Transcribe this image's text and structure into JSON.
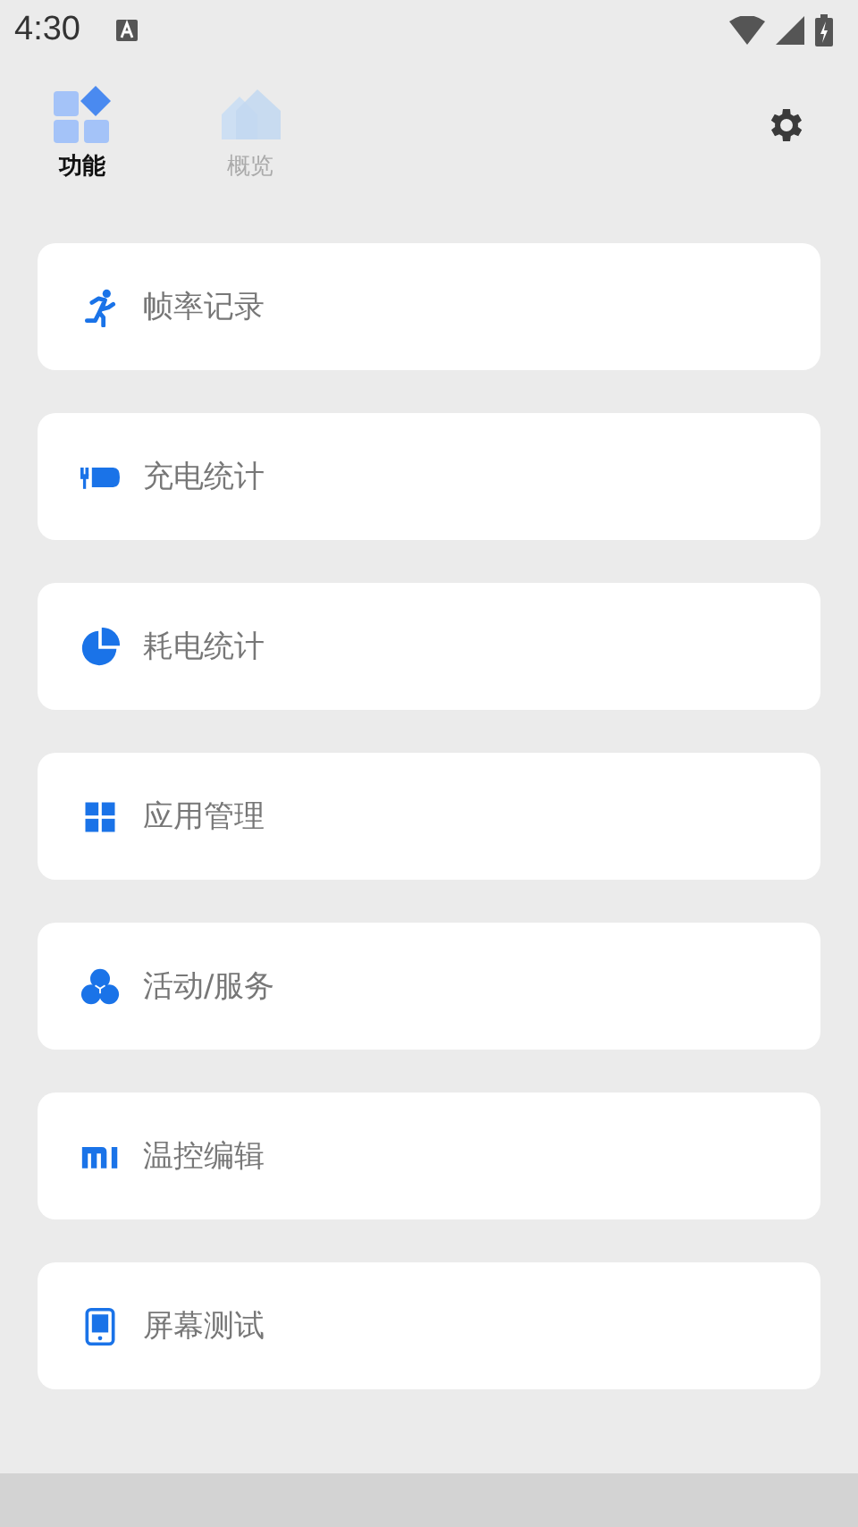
{
  "status_bar": {
    "time": "4:30"
  },
  "tabs": [
    {
      "label": "功能",
      "kind": "features",
      "selected": true
    },
    {
      "label": "概览",
      "kind": "overview",
      "selected": false
    }
  ],
  "items": [
    {
      "label": "帧率记录",
      "kind": "run"
    },
    {
      "label": "充电统计",
      "kind": "charge"
    },
    {
      "label": "耗电统计",
      "kind": "pie"
    },
    {
      "label": "应用管理",
      "kind": "grid"
    },
    {
      "label": "活动/服务",
      "kind": "circles"
    },
    {
      "label": "温控编辑",
      "kind": "mi"
    },
    {
      "label": "屏幕测试",
      "kind": "phone"
    }
  ]
}
